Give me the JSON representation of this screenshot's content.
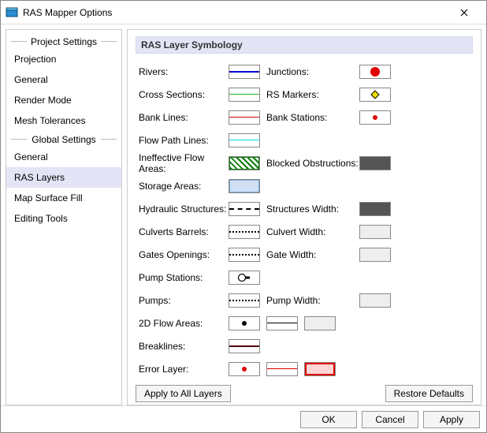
{
  "window": {
    "title": "RAS Mapper Options"
  },
  "nav": {
    "heading1": "Project Settings",
    "heading2": "Global Settings",
    "items": {
      "projection": "Projection",
      "general1": "General",
      "render_mode": "Render Mode",
      "mesh_tolerances": "Mesh Tolerances",
      "general2": "General",
      "ras_layers": "RAS Layers",
      "map_surface_fill": "Map Surface Fill",
      "editing_tools": "Editing Tools"
    }
  },
  "panel": {
    "title": "RAS Layer Symbology",
    "rows": {
      "rivers": "Rivers:",
      "junctions": "Junctions:",
      "cross_sections": "Cross Sections:",
      "rs_markers": "RS Markers:",
      "bank_lines": "Bank Lines:",
      "bank_stations": "Bank Stations:",
      "flow_path_lines": "Flow Path Lines:",
      "ineffective_flow": "Ineffective Flow Areas:",
      "blocked_obs": "Blocked Obstructions:",
      "storage_areas": "Storage Areas:",
      "hydraulic_struct": "Hydraulic Structures:",
      "structures_width": "Structures Width:",
      "culverts_barrels": "Culverts Barrels:",
      "culvert_width": "Culvert Width:",
      "gates_openings": "Gates Openings:",
      "gate_width": "Gate Width:",
      "pump_stations": "Pump Stations:",
      "pumps": "Pumps:",
      "pump_width": "Pump Width:",
      "flow_areas_2d": "2D Flow Areas:",
      "breaklines": "Breaklines:",
      "error_layer": "Error Layer:"
    },
    "apply_all": "Apply to All Layers",
    "restore_defaults": "Restore Defaults"
  },
  "footer": {
    "ok": "OK",
    "cancel": "Cancel",
    "apply": "Apply"
  }
}
